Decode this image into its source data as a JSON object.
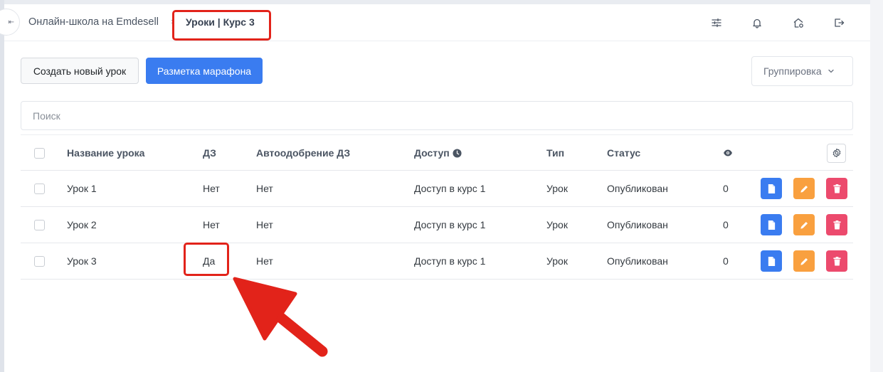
{
  "header": {
    "collapse_glyph": "⇤",
    "breadcrumb_root": "Онлайн-школа на Emdesell",
    "breadcrumb_separator": "›",
    "breadcrumb_current": "Уроки | Курс 3"
  },
  "toolbar": {
    "new_lesson_label": "Создать новый урок",
    "marathon_label": "Разметка марафона",
    "grouping_label": "Группировка"
  },
  "search": {
    "placeholder": "Поиск"
  },
  "table": {
    "columns": {
      "name": "Название урока",
      "hw": "ДЗ",
      "auto": "Автоодобрение ДЗ",
      "access": "Доступ",
      "type": "Тип",
      "status": "Статус"
    },
    "rows": [
      {
        "name": "Урок 1",
        "hw": "Нет",
        "auto": "Нет",
        "access": "Доступ в курс 1",
        "type": "Урок",
        "status": "Опубликован",
        "views": "0"
      },
      {
        "name": "Урок 2",
        "hw": "Нет",
        "auto": "Нет",
        "access": "Доступ в курс 1",
        "type": "Урок",
        "status": "Опубликован",
        "views": "0"
      },
      {
        "name": "Урок 3",
        "hw": "Да",
        "auto": "Нет",
        "access": "Доступ в курс 1",
        "type": "Урок",
        "status": "Опубликован",
        "views": "0"
      }
    ]
  },
  "colors": {
    "primary": "#3a7cf0",
    "edit": "#f9a03f",
    "delete": "#ec4a6d",
    "annotation": "#e2231a"
  },
  "icons": {
    "header": [
      "sliders-icon",
      "bell-icon",
      "home-gear-icon",
      "logout-icon"
    ],
    "row_actions": [
      "document-icon",
      "pencil-icon",
      "trash-icon"
    ]
  }
}
